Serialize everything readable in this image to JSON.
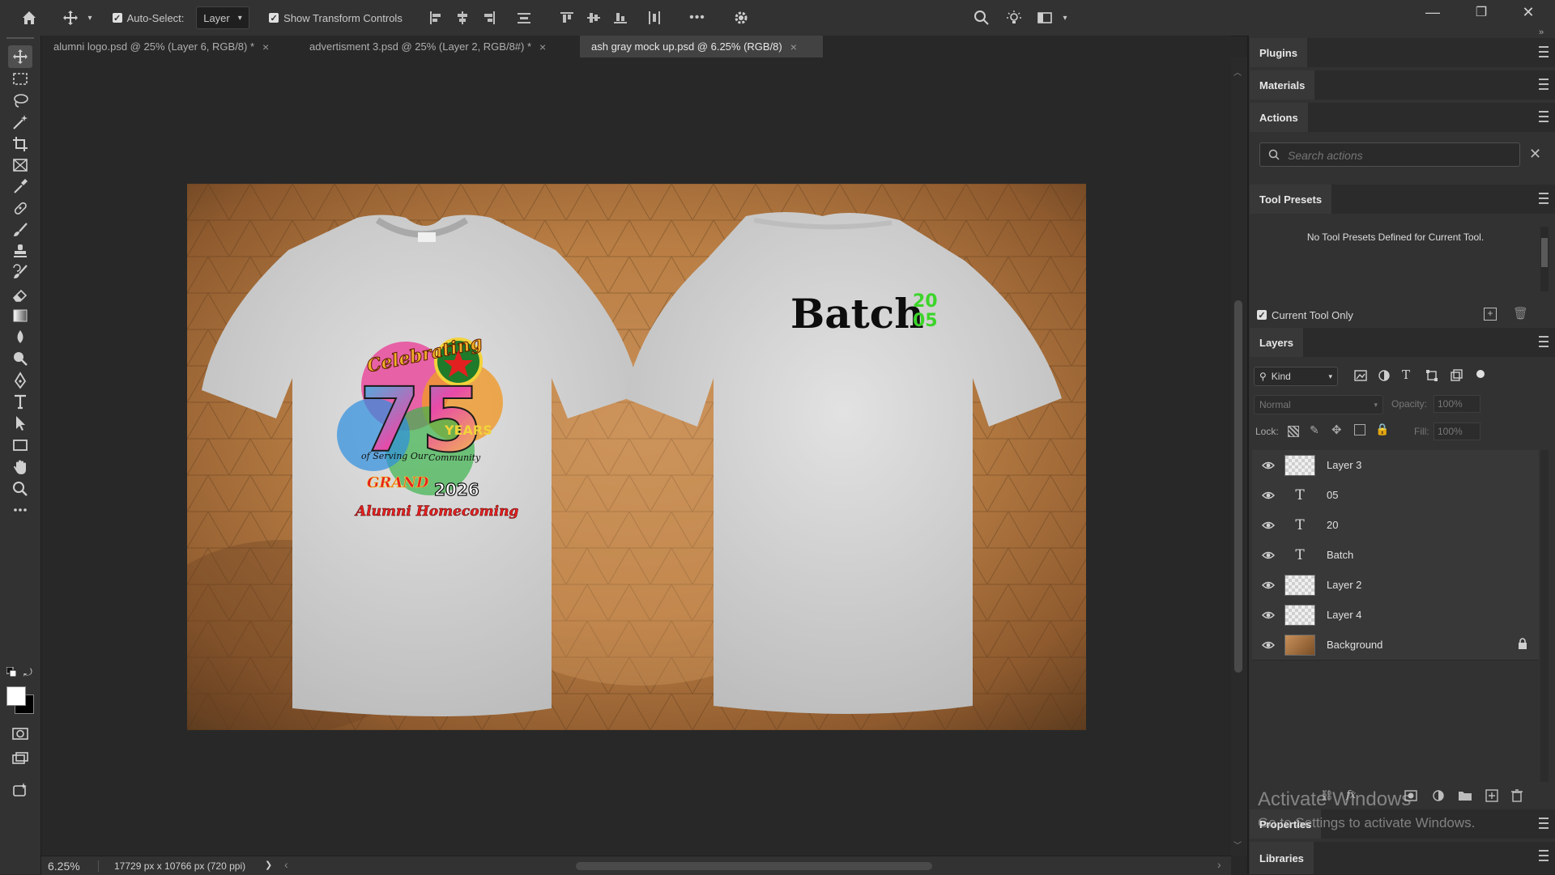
{
  "options_bar": {
    "auto_select_label": "Auto-Select:",
    "auto_select_checked": true,
    "auto_select_target": "Layer",
    "show_transform_label": "Show Transform Controls",
    "show_transform_checked": true,
    "more_label": "•••"
  },
  "window": {
    "minimize": "—",
    "restore": "❐",
    "close": "✕"
  },
  "tabs": [
    {
      "label": "alumni logo.psd @ 25% (Layer 6, RGB/8) *",
      "active": false
    },
    {
      "label": "advertisment 3.psd @ 25% (Layer 2, RGB/8#) *",
      "active": false
    },
    {
      "label": "ash gray mock up.psd @ 6.25% (RGB/8)",
      "active": true
    }
  ],
  "tools": [
    "move-tool-icon",
    "marquee-tool-icon",
    "lasso-tool-icon",
    "magic-wand-tool-icon",
    "crop-tool-icon",
    "frame-tool-icon",
    "eyedropper-tool-icon",
    "healing-brush-tool-icon",
    "brush-tool-icon",
    "clone-stamp-tool-icon",
    "history-brush-tool-icon",
    "eraser-tool-icon",
    "gradient-tool-icon",
    "blur-tool-icon",
    "dodge-tool-icon",
    "pen-tool-icon",
    "type-tool-icon",
    "path-selection-tool-icon",
    "rectangle-tool-icon",
    "hand-tool-icon",
    "zoom-tool-icon",
    "more-tools-icon"
  ],
  "document": {
    "design_front": {
      "celebrating": "Celebrating",
      "number": "75",
      "years": "YEARS",
      "tagline_left": "of Serving Our",
      "tagline_right": "Community",
      "grand": "GRAND",
      "year": "2026",
      "alumni": "Alumni Homecoming"
    },
    "design_back": {
      "batch": "Batch",
      "yy1": "20",
      "yy2": "05"
    },
    "accent_green": "#3cd42a"
  },
  "status": {
    "zoom": "6.25%",
    "doc_info": "17729 px x 10766 px (720 ppi)",
    "arrow": "❯",
    "left_arrow": "‹",
    "right_arrow": "›"
  },
  "panels": {
    "plugins": "Plugins",
    "materials": "Materials",
    "actions": {
      "title": "Actions",
      "search_placeholder": "Search actions"
    },
    "tool_presets": {
      "title": "Tool Presets",
      "empty_message": "No Tool Presets Defined for Current Tool.",
      "current_tool_only": "Current Tool Only"
    },
    "layers": {
      "title": "Layers",
      "filter_kind": "Kind",
      "blend_mode": "Normal",
      "opacity_label": "Opacity:",
      "opacity_value": "100%",
      "lock_label": "Lock:",
      "fill_label": "Fill:",
      "fill_value": "100%",
      "items": [
        {
          "name": "Layer 3",
          "kind": "pixel",
          "visible": true,
          "locked": false
        },
        {
          "name": "05",
          "kind": "type",
          "visible": true,
          "locked": false
        },
        {
          "name": "20",
          "kind": "type",
          "visible": true,
          "locked": false
        },
        {
          "name": "Batch",
          "kind": "type",
          "visible": true,
          "locked": false
        },
        {
          "name": "Layer 2",
          "kind": "pixel",
          "visible": true,
          "locked": false
        },
        {
          "name": "Layer 4",
          "kind": "pixel",
          "visible": true,
          "locked": false
        },
        {
          "name": "Background",
          "kind": "background",
          "visible": true,
          "locked": true
        }
      ],
      "type_glyph": "T"
    },
    "properties": "Properties",
    "libraries": "Libraries"
  },
  "watermark": {
    "line1": "Activate Windows",
    "line2": "Go to Settings to activate Windows."
  }
}
